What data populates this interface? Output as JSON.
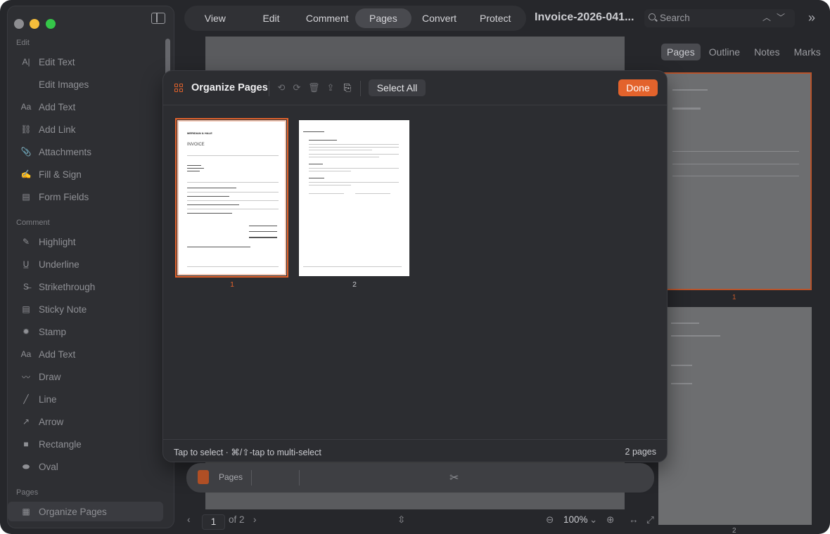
{
  "sidebar": {
    "sections": {
      "edit": "Edit",
      "comment": "Comment",
      "pages": "Pages"
    },
    "edit_items": [
      "Edit Text",
      "Edit Images",
      "Add Text",
      "Add Link",
      "Attachments",
      "Fill & Sign",
      "Form Fields"
    ],
    "comment_items": [
      "Highlight",
      "Underline",
      "Strikethrough",
      "Sticky Note",
      "Stamp",
      "Add Text",
      "Draw",
      "Line",
      "Arrow",
      "Rectangle",
      "Oval"
    ],
    "pages_items": [
      "Organize Pages"
    ]
  },
  "toolbar": {
    "tabs": [
      "View",
      "Edit",
      "Comment",
      "Pages",
      "Convert",
      "Protect"
    ],
    "active_tab": "Pages",
    "document_title": "Invoice-2026-041...",
    "search_placeholder": "Search"
  },
  "right_panel": {
    "tabs": [
      "Pages",
      "Outline",
      "Notes",
      "Marks"
    ],
    "active_tab": "Pages",
    "page_numbers": [
      "1",
      "2"
    ]
  },
  "modal": {
    "title": "Organize Pages",
    "select_all_label": "Select All",
    "done_label": "Done",
    "pages": [
      {
        "number": "1",
        "selected": true
      },
      {
        "number": "2",
        "selected": false
      }
    ],
    "hint": "Tap to select · ⌘/⇧-tap to multi-select",
    "count": "2 pages"
  },
  "thumbnail_text": {
    "company": "MERIDIAN & HALE",
    "doc_heading": "INVOICE"
  },
  "dock": {
    "label": "Pages"
  },
  "bottom_bar": {
    "current_page": "1",
    "of_pages": "of 2",
    "zoom": "100%"
  },
  "colors": {
    "accent": "#e3632c",
    "window_bg": "#26272b",
    "panel_bg": "#2c2d31"
  }
}
